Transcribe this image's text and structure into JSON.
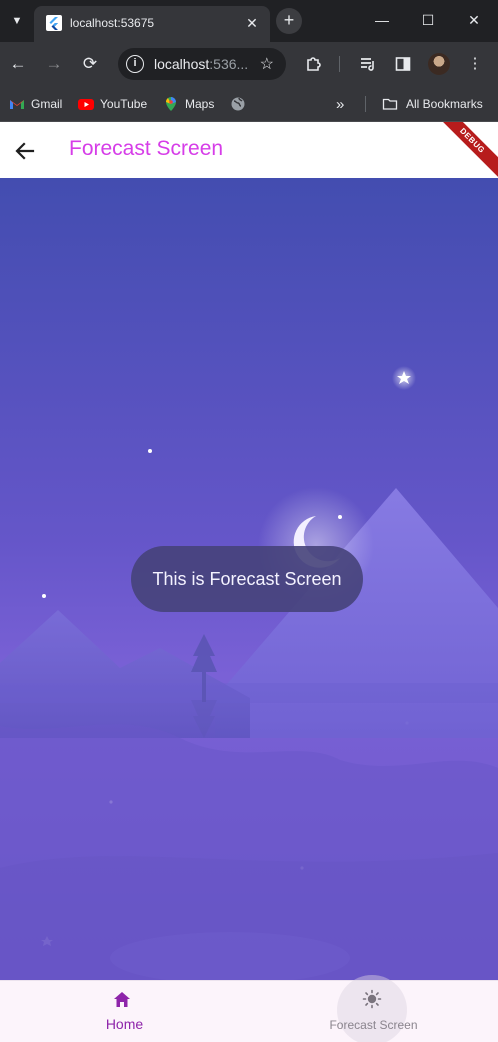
{
  "browser": {
    "tab": {
      "title": "localhost:53675",
      "close": "✕"
    },
    "new_tab": "+",
    "window": {
      "minimize": "—",
      "maximize": "☐",
      "close": "✕"
    },
    "toolbar": {
      "url_host": "localhost",
      "url_rest": ":536...",
      "back": "←",
      "forward": "→",
      "reload": "⟳",
      "star": "☆",
      "menu": "⋮"
    },
    "bookmarks": {
      "items": [
        {
          "label": "Gmail",
          "icon": "gmail-icon"
        },
        {
          "label": "YouTube",
          "icon": "youtube-icon"
        },
        {
          "label": "Maps",
          "icon": "maps-icon"
        },
        {
          "label": "",
          "icon": "globe-icon"
        }
      ],
      "overflow": "»",
      "all_bookmarks": "All Bookmarks"
    }
  },
  "app": {
    "title": "Forecast Screen",
    "debug_banner": "DEBUG",
    "accent_color": "#d63de8",
    "toast": "This is Forecast Screen",
    "bottom_nav": {
      "items": [
        {
          "label": "Home",
          "icon": "home-icon",
          "selected": true
        },
        {
          "label": "Forecast Screen",
          "icon": "sun-icon",
          "selected": false
        }
      ]
    }
  }
}
